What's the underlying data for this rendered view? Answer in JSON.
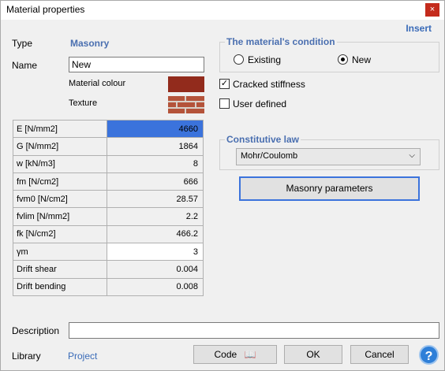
{
  "window": {
    "title": "Material properties",
    "close_glyph": "×"
  },
  "header": {
    "insert_label": "Insert"
  },
  "type": {
    "label": "Type",
    "value": "Masonry"
  },
  "name": {
    "label": "Name",
    "value": "New"
  },
  "material_colour": {
    "label": "Material colour",
    "color": "#922b1c"
  },
  "texture": {
    "label": "Texture"
  },
  "properties": [
    {
      "name": "E [N/mm2]",
      "value": "4660"
    },
    {
      "name": "G [N/mm2]",
      "value": "1864"
    },
    {
      "name": "w [kN/m3]",
      "value": "8"
    },
    {
      "name": "fm [N/cm2]",
      "value": "666"
    },
    {
      "name": "fvm0 [N/cm2]",
      "value": "28.57"
    },
    {
      "name": "fvlim [N/mm2]",
      "value": "2.2"
    },
    {
      "name": "fk [N/cm2]",
      "value": "466.2"
    },
    {
      "name": "γm",
      "value": "3"
    },
    {
      "name": "Drift shear",
      "value": "0.004"
    },
    {
      "name": "Drift bending",
      "value": "0.008"
    }
  ],
  "condition": {
    "title": "The material's condition",
    "existing_label": "Existing",
    "new_label": "New",
    "selected": "New"
  },
  "cracked_stiffness": {
    "label": "Cracked stiffness",
    "checked": true,
    "check_glyph": "✓"
  },
  "user_defined": {
    "label": "User defined",
    "checked": false
  },
  "constitutive": {
    "title": "Constitutive law",
    "selected": "Mohr/Coulomb",
    "arrow_glyph": "⌵"
  },
  "masonry_parameters_label": "Masonry parameters",
  "description": {
    "label": "Description",
    "value": ""
  },
  "library": {
    "label": "Library",
    "value": "Project"
  },
  "buttons": {
    "code": "Code",
    "code_icon": "📖",
    "ok": "OK",
    "cancel": "Cancel",
    "help": "?"
  },
  "colors": {
    "accent": "#3a6bb8",
    "selection": "#3b73dc",
    "close": "#c42b1c",
    "help": "#2e7fd8"
  }
}
